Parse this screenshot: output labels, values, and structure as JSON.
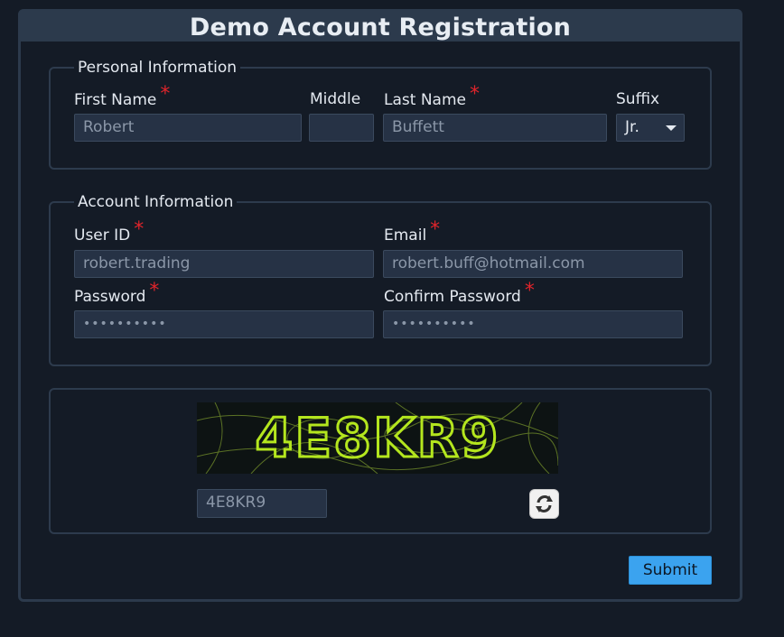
{
  "form": {
    "title": "Demo Account Registration",
    "submit_label": "Submit"
  },
  "personal": {
    "legend": "Personal Information",
    "first_name": {
      "label": "First Name",
      "required_mark": "*",
      "value": "Robert"
    },
    "middle": {
      "label": "Middle",
      "value": ""
    },
    "last_name": {
      "label": "Last Name",
      "required_mark": "*",
      "value": "Buffett"
    },
    "suffix": {
      "label": "Suffix",
      "selected": "Jr."
    }
  },
  "account": {
    "legend": "Account Information",
    "user_id": {
      "label": "User ID",
      "required_mark": "*",
      "value": "robert.trading"
    },
    "email": {
      "label": "Email",
      "required_mark": "*",
      "value": "robert.buff@hotmail.com"
    },
    "password": {
      "label": "Password",
      "required_mark": "*",
      "value": "••••••••••"
    },
    "confirm_password": {
      "label": "Confirm Password",
      "required_mark": "*",
      "value": "••••••••••"
    }
  },
  "captcha": {
    "image_text": "4E8KR9",
    "input_value": "4E8KR9",
    "refresh_icon": "refresh-icon"
  },
  "colors": {
    "background": "#141b26",
    "header": "#2c3a4c",
    "input_bg": "#263245",
    "required": "#e0242b",
    "submit": "#3ba3ef",
    "captcha_text": "#b4e61e"
  }
}
